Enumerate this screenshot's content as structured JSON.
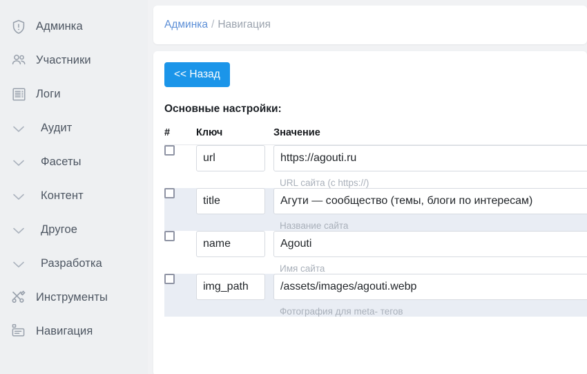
{
  "sidebar": {
    "items": [
      {
        "label": "Админка",
        "icon": "shield-alert-icon",
        "type": "link"
      },
      {
        "label": "Участники",
        "icon": "users-icon",
        "type": "link"
      },
      {
        "label": "Логи",
        "icon": "logs-receipt-icon",
        "type": "link"
      },
      {
        "label": "Аудит",
        "icon": "chevron-down-icon",
        "type": "group"
      },
      {
        "label": "Фасеты",
        "icon": "chevron-down-icon",
        "type": "group"
      },
      {
        "label": "Контент",
        "icon": "chevron-down-icon",
        "type": "group"
      },
      {
        "label": "Другое",
        "icon": "chevron-down-icon",
        "type": "group"
      },
      {
        "label": "Разработка",
        "icon": "chevron-down-icon",
        "type": "group"
      },
      {
        "label": "Инструменты",
        "icon": "tools-icon",
        "type": "link"
      },
      {
        "label": "Навигация",
        "icon": "navigation-card-icon",
        "type": "link"
      }
    ]
  },
  "breadcrumb": {
    "root": "Админка",
    "separator": "/",
    "current": "Навигация"
  },
  "toolbar": {
    "back_label": "<< Назад"
  },
  "section": {
    "title": "Основные настройки:"
  },
  "table": {
    "headers": {
      "num": "#",
      "key": "Ключ",
      "value": "Значение"
    },
    "rows": [
      {
        "checked": false,
        "key": "url",
        "value": "https://agouti.ru",
        "hint": "URL сайта (с https://)"
      },
      {
        "checked": false,
        "key": "title",
        "value": "Агути — сообщество (темы, блоги по интересам)",
        "hint": "Название сайта"
      },
      {
        "checked": false,
        "key": "name",
        "value": "Agouti",
        "hint": "Имя сайта"
      },
      {
        "checked": false,
        "key": "img_path",
        "value": "/assets/images/agouti.webp",
        "hint": "Фотография для meta- тегов"
      }
    ]
  },
  "colors": {
    "accent_blue": "#1b95e9",
    "link_blue": "#5b8ed6",
    "sidebar_bg": "#eef0f2",
    "page_bg": "#f1f2f4",
    "stripe_bg": "#e9edf4",
    "muted_text": "#a9b0ba"
  }
}
